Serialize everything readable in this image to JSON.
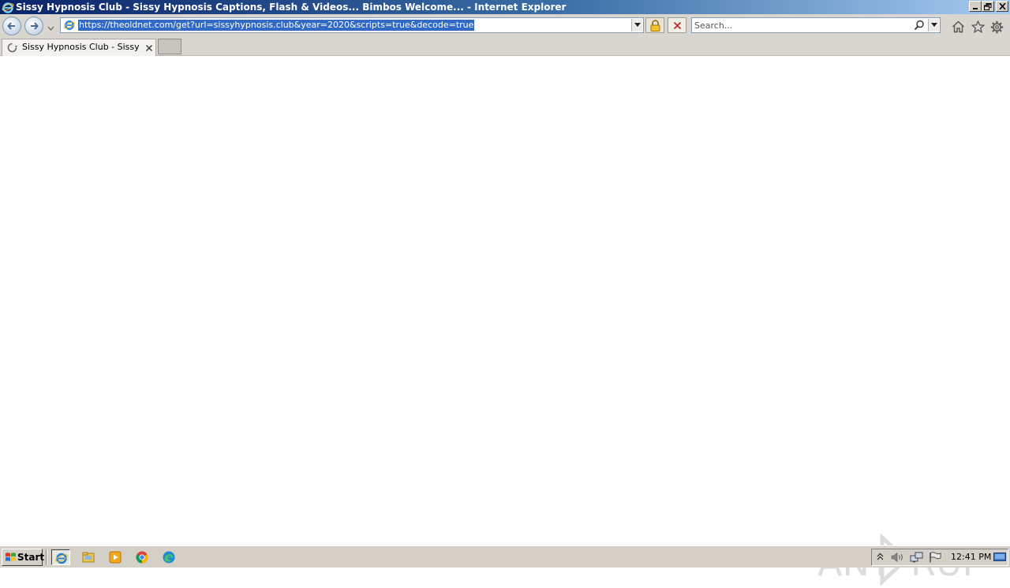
{
  "window": {
    "title": "Sissy Hypnosis Club - Sissy Hypnosis Captions, Flash & Videos... Bimbos Welcome... - Internet Explorer",
    "controls": {
      "minimize": "0",
      "restore": "2",
      "close": "✕"
    }
  },
  "address": {
    "url": "https://theoldnet.com/get?url=sissyhypnosis.club&year=2020&scripts=true&decode=true"
  },
  "search": {
    "placeholder": "Search..."
  },
  "tabs": [
    {
      "label": "Sissy Hypnosis Club - Sissy H...",
      "loading": true
    }
  ],
  "taskbar": {
    "start_label": "Start",
    "apps": [
      "internet-explorer",
      "file-explorer",
      "media-player",
      "chrome",
      "edge"
    ],
    "clock": "12:41 PM"
  },
  "watermark": {
    "text_left": "ANY",
    "text_right": "RUN"
  },
  "colors": {
    "titlebar_start": "#0a246a",
    "titlebar_end": "#a6caf0",
    "chrome_bg": "#d9d5cf",
    "selection": "#316ac5",
    "taskbar_bg": "#d4d0c8"
  }
}
